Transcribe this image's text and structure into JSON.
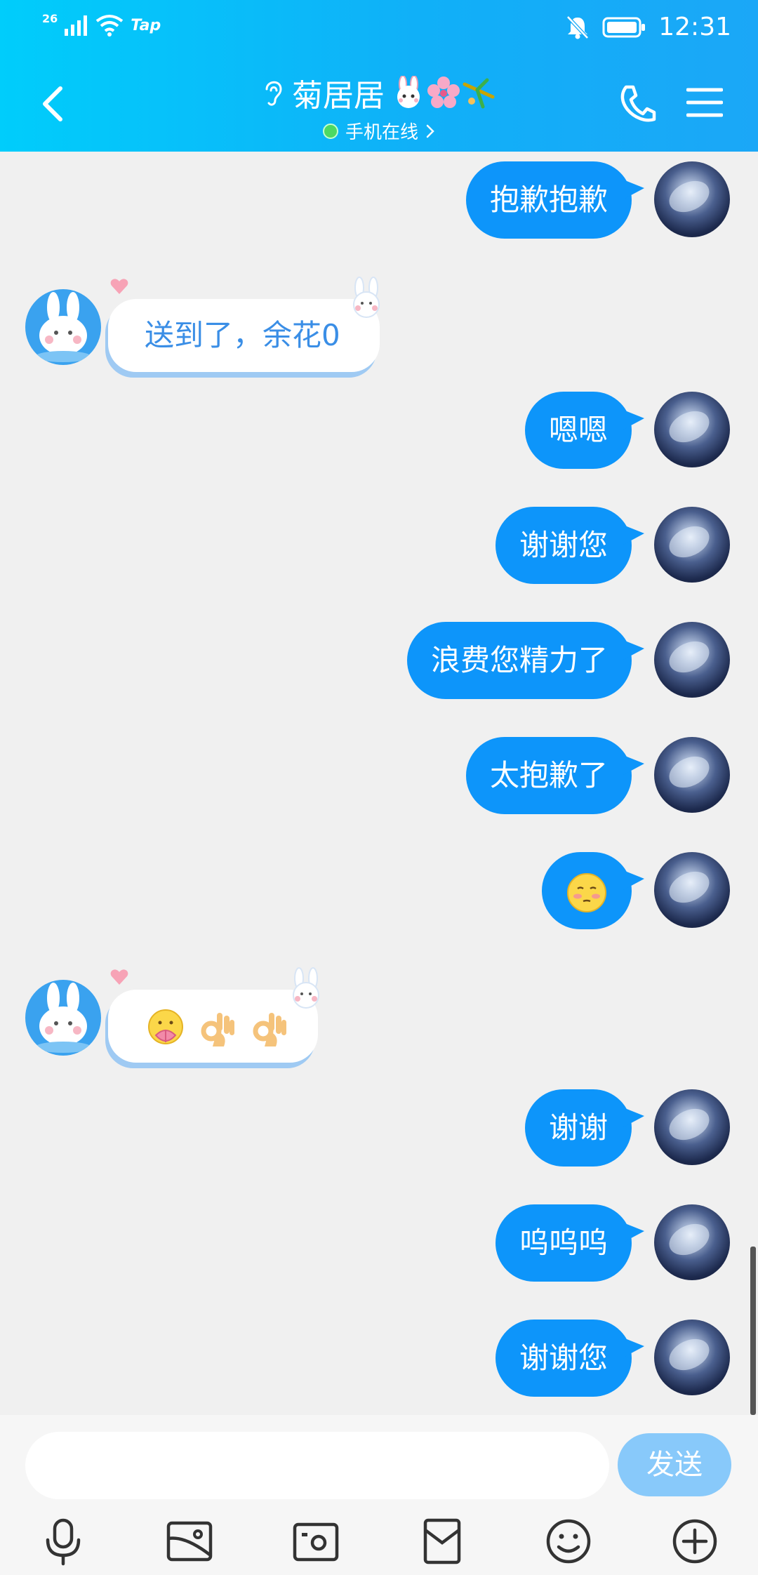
{
  "status_bar": {
    "network": "26",
    "carrier": "Tap",
    "time": "12:31"
  },
  "header": {
    "contact_name": "菊居居",
    "online_status": "手机在线"
  },
  "messages": [
    {
      "dir": "out",
      "text": "抱歉抱歉"
    },
    {
      "dir": "in",
      "text": "送到了，余花0"
    },
    {
      "dir": "out",
      "text": "嗯嗯"
    },
    {
      "dir": "out",
      "text": "谢谢您"
    },
    {
      "dir": "out",
      "text": "浪费您精力了"
    },
    {
      "dir": "out",
      "text": "太抱歉了"
    },
    {
      "dir": "out",
      "emoji": "blushing-face"
    },
    {
      "dir": "in",
      "emoji": [
        "lotus-face",
        "ok-hand",
        "ok-hand"
      ]
    },
    {
      "dir": "out",
      "text": "谢谢"
    },
    {
      "dir": "out",
      "text": "呜呜呜"
    },
    {
      "dir": "out",
      "text": "谢谢您"
    }
  ],
  "composer": {
    "input_value": "",
    "send_label": "发送"
  },
  "toolbar_icons": [
    "microphone-icon",
    "image-icon",
    "camera-icon",
    "red-packet-icon",
    "emoji-icon",
    "plus-icon"
  ],
  "colors": {
    "header_start": "#00cdfb",
    "header_end": "#1ba7f7",
    "outgoing_bubble": "#0d95fa",
    "incoming_text": "#3a8ee6",
    "send_button": "#88c9fa",
    "background": "#f0f0f0"
  }
}
